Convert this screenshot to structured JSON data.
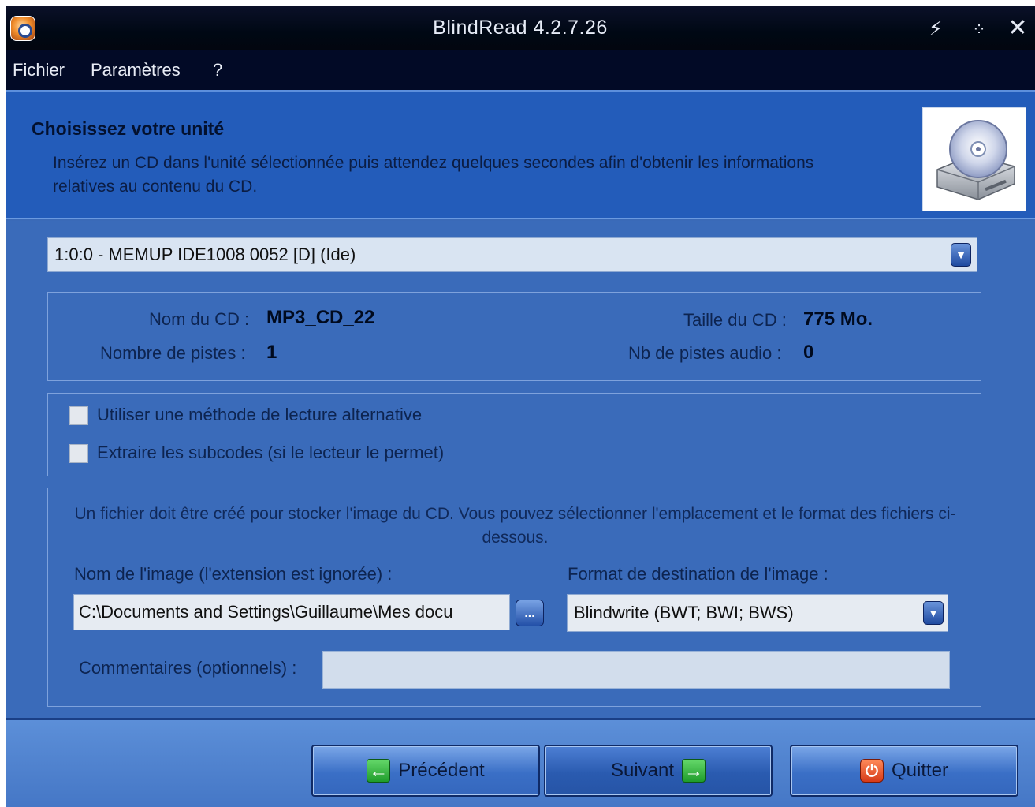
{
  "window": {
    "title": "BlindRead 4.2.7.26",
    "titlebar_buttons": [
      "shade-icon",
      "minimize-icon",
      "close-icon"
    ]
  },
  "menu": {
    "items": [
      "Fichier",
      "Paramètres",
      "?"
    ]
  },
  "header": {
    "title": "Choisissez votre unité",
    "description": "Insérez un CD dans l'unité sélectionnée puis attendez quelques secondes afin d'obtenir les informations relatives au contenu du CD.",
    "icon": "cd-drive-icon"
  },
  "drive": {
    "selected": "1:0:0 - MEMUP IDE1008 0052 [D] (Ide)"
  },
  "cd_info": {
    "name_label": "Nom du CD :",
    "name_value": "MP3_CD_22",
    "size_label": "Taille du CD :",
    "size_value": "775 Mo.",
    "tracks_label": "Nombre de pistes :",
    "tracks_value": "1",
    "audio_tracks_label": "Nb de pistes audio :",
    "audio_tracks_value": "0"
  },
  "options": {
    "alt_read_label": "Utiliser une méthode de lecture alternative",
    "alt_read_checked": false,
    "subcodes_label": "Extraire les subcodes (si le lecteur le permet)",
    "subcodes_checked": false
  },
  "file": {
    "description": "Un fichier doit être créé pour stocker l'image du CD. Vous pouvez sélectionner l'emplacement et le format des fichiers ci-dessous.",
    "image_name_label": "Nom de l'image (l'extension est ignorée) :",
    "image_path": "C:\\Documents and Settings\\Guillaume\\Mes docu",
    "browse_label": "...",
    "format_label": "Format de destination de l'image :",
    "format_value": "Blindwrite (BWT; BWI; BWS)",
    "comments_label": "Commentaires (optionnels) :",
    "comments_value": ""
  },
  "footer": {
    "previous_label": "Précédent",
    "next_label": "Suivant",
    "quit_label": "Quitter"
  }
}
